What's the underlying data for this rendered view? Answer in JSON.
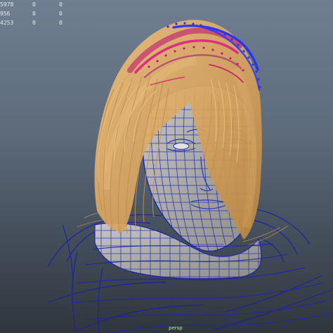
{
  "viewport": {
    "hud_rows": [
      {
        "label": "5978",
        "col1": "0",
        "col2": "0"
      },
      {
        "label": "956",
        "col1": "0",
        "col2": "0"
      },
      {
        "label": "4253",
        "col1": "0",
        "col2": "0"
      }
    ],
    "status_text": "persp"
  },
  "colors": {
    "background_top": "#6f7f91",
    "background_bottom": "#30363d",
    "mesh_wire": "#1f2aa8",
    "hair": "#d7a65e",
    "hair_highlight": "#f2c57b",
    "guide_selected": "#d6007a",
    "guide_blue": "#2430ff",
    "skin": "#a9a7a6"
  },
  "icons": [
    "viewport-grid-icon"
  ]
}
